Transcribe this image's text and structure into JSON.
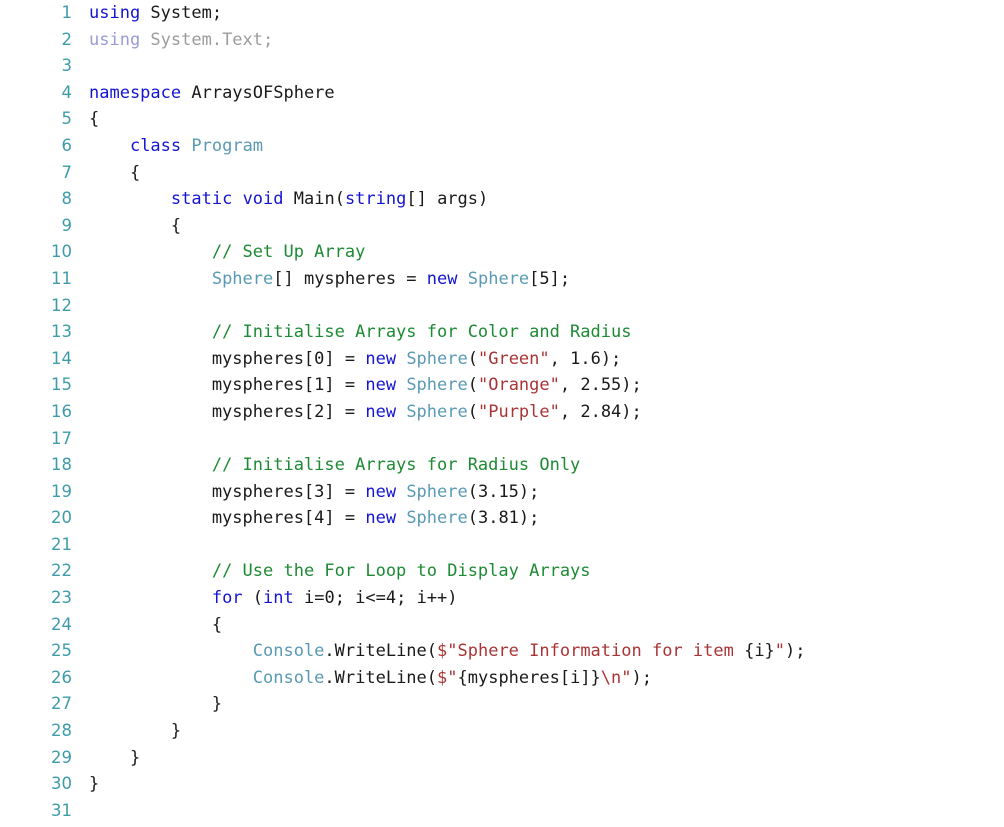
{
  "editor": {
    "language": "C#",
    "background_color": "#ffffff",
    "gutter_color": "#3e9caa",
    "first_line_number": 1,
    "last_line_number": 31,
    "total_lines": 31
  },
  "colors": {
    "plain": "#1a1a1a",
    "keyword": "#1414d2",
    "type": "#5a9ab5",
    "comment": "#1d8a34",
    "string": "#a93436",
    "dimmed_keyword": "#9a9ad8",
    "dimmed_text": "#9c9c9c",
    "line_number": "#3e9caa"
  },
  "lines": [
    {
      "n": "1",
      "tokens": [
        {
          "t": "using",
          "c": "keyword"
        },
        {
          "t": " System;",
          "c": "plain"
        }
      ]
    },
    {
      "n": "2",
      "tokens": [
        {
          "t": "using",
          "c": "dim-kw"
        },
        {
          "t": " System.Text;",
          "c": "dim"
        }
      ]
    },
    {
      "n": "3",
      "tokens": []
    },
    {
      "n": "4",
      "tokens": [
        {
          "t": "namespace",
          "c": "keyword"
        },
        {
          "t": " ArraysOFSphere",
          "c": "plain"
        }
      ]
    },
    {
      "n": "5",
      "tokens": [
        {
          "t": "{",
          "c": "plain"
        }
      ]
    },
    {
      "n": "6",
      "tokens": [
        {
          "t": "    ",
          "c": "plain"
        },
        {
          "t": "class",
          "c": "keyword"
        },
        {
          "t": " ",
          "c": "plain"
        },
        {
          "t": "Program",
          "c": "type"
        }
      ]
    },
    {
      "n": "7",
      "tokens": [
        {
          "t": "    {",
          "c": "plain"
        }
      ]
    },
    {
      "n": "8",
      "tokens": [
        {
          "t": "        ",
          "c": "plain"
        },
        {
          "t": "static",
          "c": "keyword"
        },
        {
          "t": " ",
          "c": "plain"
        },
        {
          "t": "void",
          "c": "keyword"
        },
        {
          "t": " Main(",
          "c": "plain"
        },
        {
          "t": "string",
          "c": "keyword"
        },
        {
          "t": "[] args)",
          "c": "plain"
        }
      ]
    },
    {
      "n": "9",
      "tokens": [
        {
          "t": "        {",
          "c": "plain"
        }
      ]
    },
    {
      "n": "10",
      "tokens": [
        {
          "t": "            ",
          "c": "plain"
        },
        {
          "t": "// Set Up Array",
          "c": "comment"
        }
      ]
    },
    {
      "n": "11",
      "tokens": [
        {
          "t": "            ",
          "c": "plain"
        },
        {
          "t": "Sphere",
          "c": "type"
        },
        {
          "t": "[] myspheres = ",
          "c": "plain"
        },
        {
          "t": "new",
          "c": "keyword"
        },
        {
          "t": " ",
          "c": "plain"
        },
        {
          "t": "Sphere",
          "c": "type"
        },
        {
          "t": "[5];",
          "c": "plain"
        }
      ]
    },
    {
      "n": "12",
      "tokens": []
    },
    {
      "n": "13",
      "tokens": [
        {
          "t": "            ",
          "c": "plain"
        },
        {
          "t": "// Initialise Arrays for Color and Radius",
          "c": "comment"
        }
      ]
    },
    {
      "n": "14",
      "tokens": [
        {
          "t": "            myspheres[0] = ",
          "c": "plain"
        },
        {
          "t": "new",
          "c": "keyword"
        },
        {
          "t": " ",
          "c": "plain"
        },
        {
          "t": "Sphere",
          "c": "type"
        },
        {
          "t": "(",
          "c": "plain"
        },
        {
          "t": "\"Green\"",
          "c": "string"
        },
        {
          "t": ", 1.6);",
          "c": "plain"
        }
      ]
    },
    {
      "n": "15",
      "tokens": [
        {
          "t": "            myspheres[1] = ",
          "c": "plain"
        },
        {
          "t": "new",
          "c": "keyword"
        },
        {
          "t": " ",
          "c": "plain"
        },
        {
          "t": "Sphere",
          "c": "type"
        },
        {
          "t": "(",
          "c": "plain"
        },
        {
          "t": "\"Orange\"",
          "c": "string"
        },
        {
          "t": ", 2.55);",
          "c": "plain"
        }
      ]
    },
    {
      "n": "16",
      "tokens": [
        {
          "t": "            myspheres[2] = ",
          "c": "plain"
        },
        {
          "t": "new",
          "c": "keyword"
        },
        {
          "t": " ",
          "c": "plain"
        },
        {
          "t": "Sphere",
          "c": "type"
        },
        {
          "t": "(",
          "c": "plain"
        },
        {
          "t": "\"Purple\"",
          "c": "string"
        },
        {
          "t": ", 2.84);",
          "c": "plain"
        }
      ]
    },
    {
      "n": "17",
      "tokens": []
    },
    {
      "n": "18",
      "tokens": [
        {
          "t": "            ",
          "c": "plain"
        },
        {
          "t": "// Initialise Arrays for Radius Only",
          "c": "comment"
        }
      ]
    },
    {
      "n": "19",
      "tokens": [
        {
          "t": "            myspheres[3] = ",
          "c": "plain"
        },
        {
          "t": "new",
          "c": "keyword"
        },
        {
          "t": " ",
          "c": "plain"
        },
        {
          "t": "Sphere",
          "c": "type"
        },
        {
          "t": "(3.15);",
          "c": "plain"
        }
      ]
    },
    {
      "n": "20",
      "tokens": [
        {
          "t": "            myspheres[4] = ",
          "c": "plain"
        },
        {
          "t": "new",
          "c": "keyword"
        },
        {
          "t": " ",
          "c": "plain"
        },
        {
          "t": "Sphere",
          "c": "type"
        },
        {
          "t": "(3.81);",
          "c": "plain"
        }
      ]
    },
    {
      "n": "21",
      "tokens": []
    },
    {
      "n": "22",
      "tokens": [
        {
          "t": "            ",
          "c": "plain"
        },
        {
          "t": "// Use the For Loop to Display Arrays",
          "c": "comment"
        }
      ]
    },
    {
      "n": "23",
      "tokens": [
        {
          "t": "            ",
          "c": "plain"
        },
        {
          "t": "for",
          "c": "keyword"
        },
        {
          "t": " (",
          "c": "plain"
        },
        {
          "t": "int",
          "c": "keyword"
        },
        {
          "t": " i=0; i<=4; i++)",
          "c": "plain"
        }
      ]
    },
    {
      "n": "24",
      "tokens": [
        {
          "t": "            {",
          "c": "plain"
        }
      ]
    },
    {
      "n": "25",
      "tokens": [
        {
          "t": "                ",
          "c": "plain"
        },
        {
          "t": "Console",
          "c": "type"
        },
        {
          "t": ".WriteLine(",
          "c": "plain"
        },
        {
          "t": "$\"",
          "c": "string"
        },
        {
          "t": "Sphere Information for item ",
          "c": "string"
        },
        {
          "t": "{i}",
          "c": "plain"
        },
        {
          "t": "\"",
          "c": "string"
        },
        {
          "t": ");",
          "c": "plain"
        }
      ]
    },
    {
      "n": "26",
      "tokens": [
        {
          "t": "                ",
          "c": "plain"
        },
        {
          "t": "Console",
          "c": "type"
        },
        {
          "t": ".WriteLine(",
          "c": "plain"
        },
        {
          "t": "$\"",
          "c": "string"
        },
        {
          "t": "{myspheres[i]}",
          "c": "plain"
        },
        {
          "t": "\\n",
          "c": "escape"
        },
        {
          "t": "\"",
          "c": "string"
        },
        {
          "t": ");",
          "c": "plain"
        }
      ]
    },
    {
      "n": "27",
      "tokens": [
        {
          "t": "            }",
          "c": "plain"
        }
      ]
    },
    {
      "n": "28",
      "tokens": [
        {
          "t": "        }",
          "c": "plain"
        }
      ]
    },
    {
      "n": "29",
      "tokens": [
        {
          "t": "    }",
          "c": "plain"
        }
      ]
    },
    {
      "n": "30",
      "tokens": [
        {
          "t": "}",
          "c": "plain"
        }
      ]
    },
    {
      "n": "31",
      "tokens": []
    }
  ]
}
